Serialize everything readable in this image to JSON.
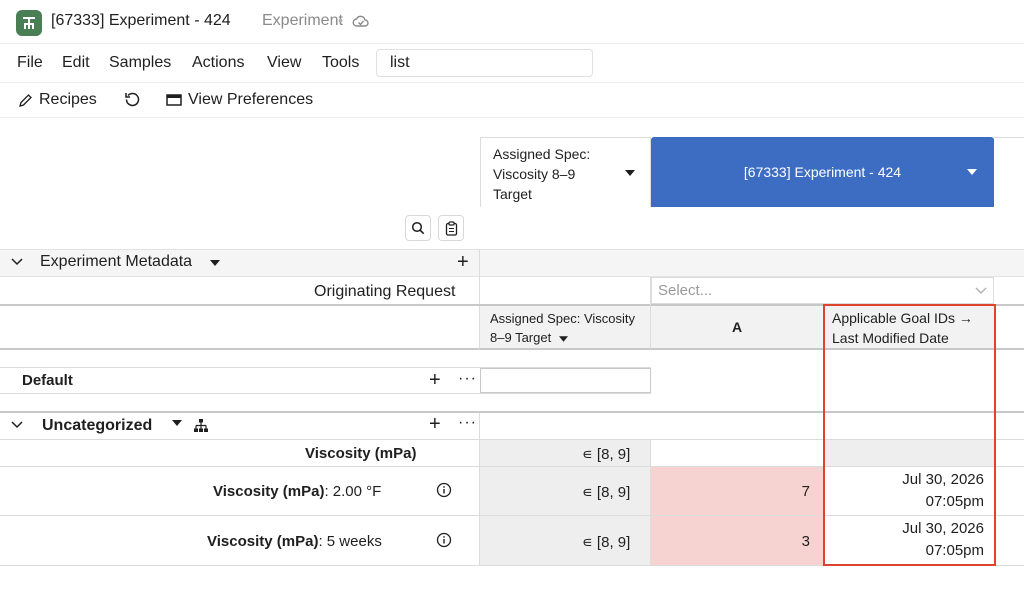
{
  "window": {
    "title": "[67333] Experiment - 424",
    "doc_type": "Experiment",
    "separator": "•"
  },
  "menu": {
    "items": [
      "File",
      "Edit",
      "Samples",
      "Actions",
      "View",
      "Tools"
    ],
    "search_value": "list"
  },
  "toolbar": {
    "recipes_label": "Recipes",
    "view_prefs_label": "View Preferences"
  },
  "grid": {
    "spec_header": "Assigned Spec: Viscosity 8–9 Target",
    "sample_header": "[67333] Experiment - 424",
    "metadata_section": "Experiment Metadata",
    "originating_request_label": "Originating Request",
    "select_placeholder": "Select...",
    "col_spec_sub": "Assigned Spec: Viscosity 8–9 Target",
    "col_a": "A",
    "col_goal_ids": "Applicable Goal IDs → Last Modified Date",
    "default_section": "Default",
    "uncategorized_section": "Uncategorized",
    "rows": [
      {
        "label_bold": "Viscosity (mPa)",
        "label_rest": "",
        "spec": "∊ [8, 9]",
        "value_a": "",
        "date_1": "",
        "date_2": ""
      },
      {
        "label_bold": "Viscosity (mPa)",
        "label_rest": ": 2.00 °F",
        "spec": "∊ [8, 9]",
        "value_a": "7",
        "date_1": "Jul 30, 2026",
        "date_2": "07:05pm"
      },
      {
        "label_bold": "Viscosity (mPa)",
        "label_rest": ": 5 weeks",
        "spec": "∊ [8, 9]",
        "value_a": "3",
        "date_1": "Jul 30, 2026",
        "date_2": "07:05pm"
      }
    ]
  },
  "colors": {
    "brand": "#4a7f56",
    "sample_header": "#3d6cc3",
    "highlight": "#e0432d",
    "out_of_spec": "#f6d3d1"
  }
}
